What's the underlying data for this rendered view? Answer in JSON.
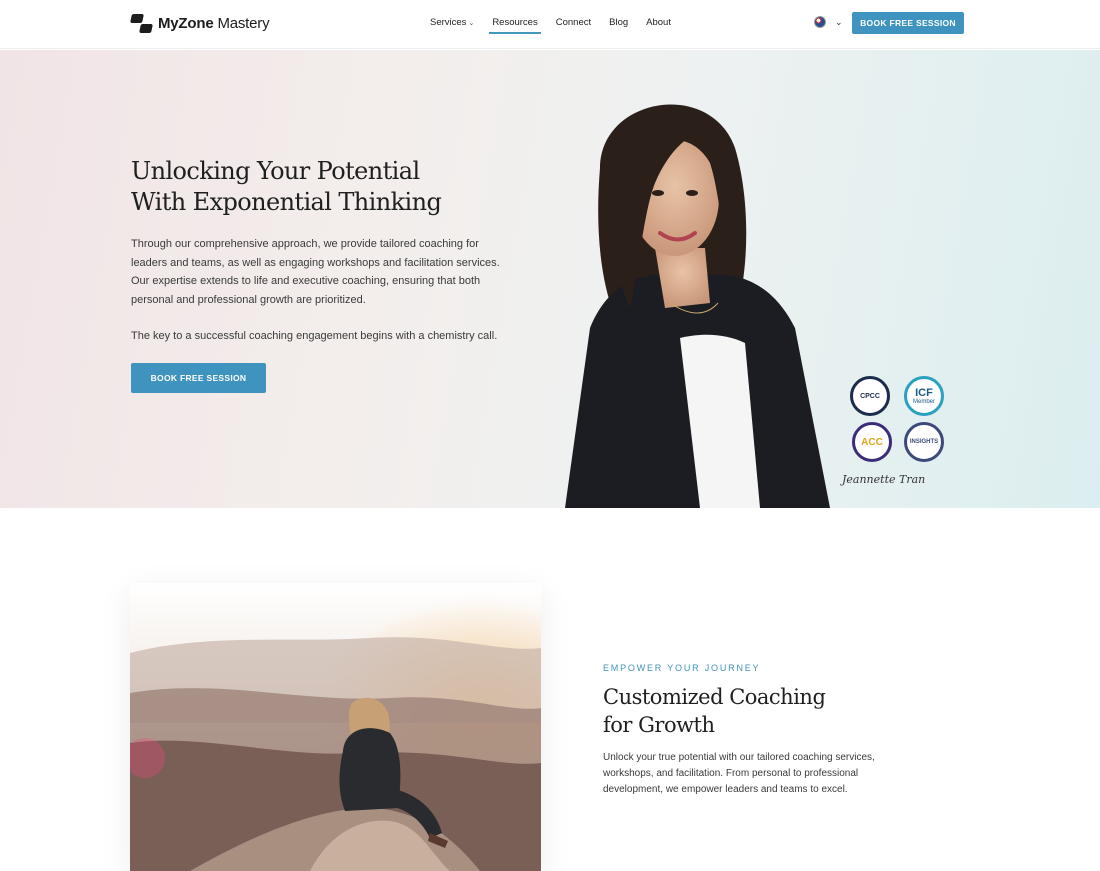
{
  "brand": {
    "name_bold": "MyZone",
    "name_light": "Mastery"
  },
  "nav": {
    "items": [
      {
        "label": "Services",
        "has_dropdown": true
      },
      {
        "label": "Resources",
        "active": true
      },
      {
        "label": "Connect"
      },
      {
        "label": "Blog"
      },
      {
        "label": "About"
      }
    ],
    "cta_label": "BOOK FREE SESSION"
  },
  "hero": {
    "title_line1": "Unlocking Your Potential",
    "title_line2": "With Exponential Thinking",
    "paragraph": "Through our comprehensive approach, we provide tailored coaching for leaders and teams, as well as engaging workshops and facilitation services. Our expertise extends to life and executive coaching, ensuring that both personal and professional growth are prioritized.",
    "paragraph2": "The key to a successful coaching engagement begins with a chemistry call.",
    "cta_label": "BOOK FREE SESSION",
    "signature": "Jeannette Tran",
    "badges": [
      {
        "label": "CPCC"
      },
      {
        "label": "ICF",
        "sub": "Member"
      },
      {
        "label": "ACC"
      },
      {
        "label": "INSIGHTS"
      }
    ]
  },
  "section2": {
    "eyebrow": "EMPOWER YOUR JOURNEY",
    "title_line1": "Customized Coaching",
    "title_line2": "for Growth",
    "body": "Unlock your true potential with our tailored coaching services, workshops, and facilitation. From personal to professional development, we empower leaders and teams to excel."
  },
  "colors": {
    "accent": "#3f93bf",
    "text": "#1f1f1f"
  }
}
